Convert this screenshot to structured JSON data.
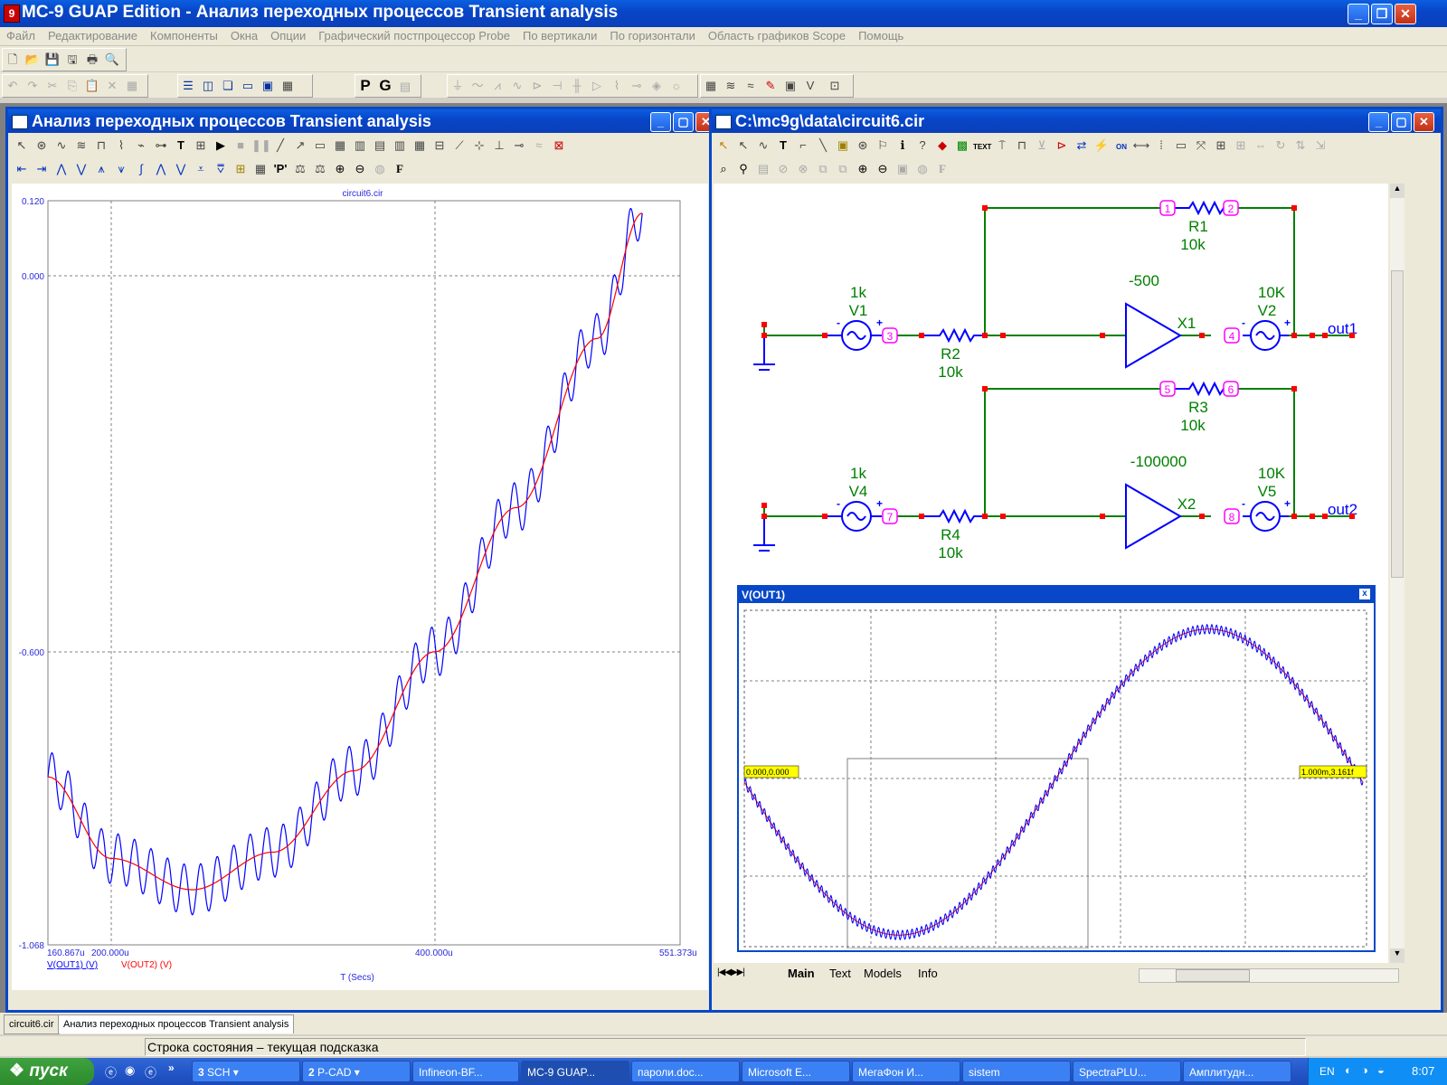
{
  "window": {
    "title": "MC-9 GUAP Edition - Анализ переходных процессов Transient analysis",
    "app_icon": "9"
  },
  "menu": [
    "Файл",
    "Редактирование",
    "Компоненты",
    "Окна",
    "Опции",
    "Графический постпроцессор Probe",
    "По вертикали",
    "По горизонтали",
    "Область графиков Scope",
    "Помощь"
  ],
  "toolbar": {
    "p_label": "P",
    "g_label": "G"
  },
  "analysis_window": {
    "title": "Анализ переходных процессов Transient analysis",
    "toolbar_p": "'P'",
    "toolbar_f": "F",
    "plot": {
      "header": "circuit6.cir",
      "y_ticks": [
        "0.120",
        "0.000",
        "-0.600",
        "-1.068"
      ],
      "x_ticks": [
        "160.867u",
        "200.000u",
        "400.000u",
        "551.373u"
      ],
      "legend": [
        {
          "label": "V(OUT1) (V)",
          "color": "#0000ff"
        },
        {
          "label": "V(OUT2) (V)",
          "color": "#ff0000"
        }
      ],
      "xlabel": "T (Secs)"
    }
  },
  "chart_data": {
    "type": "line",
    "xlabel": "T (Secs)",
    "xlim": [
      160.867,
      551.373
    ],
    "ylim": [
      -1.068,
      0.12
    ],
    "series": [
      {
        "name": "V(OUT1) (V)",
        "color": "#0000ff",
        "base": "parabola",
        "ripple_amplitude": 0.04,
        "ripple_cycles": 36
      },
      {
        "name": "V(OUT2) (V)",
        "color": "#ff0000",
        "base": "parabola"
      }
    ],
    "x": [
      160.867,
      200,
      250,
      300,
      350,
      400,
      450,
      500,
      528
    ],
    "y": [
      -0.8,
      -0.93,
      -0.98,
      -0.92,
      -0.79,
      -0.6,
      -0.37,
      -0.1,
      0.1
    ]
  },
  "schematic_window": {
    "title": "C:\\mc9g\\data\\circuit6.cir",
    "toolbar_text": "TEXT",
    "toolbar_on": "ON",
    "toolbar_f": "F",
    "components": {
      "R1": {
        "name": "R1",
        "value": "10k"
      },
      "R2": {
        "name": "R2",
        "value": "10k"
      },
      "R3": {
        "name": "R3",
        "value": "10k"
      },
      "R4": {
        "name": "R4",
        "value": "10k"
      },
      "V1": {
        "name": "V1",
        "value": "1k"
      },
      "V2": {
        "name": "V2",
        "value": "10K"
      },
      "V4": {
        "name": "V4",
        "value": "1k"
      },
      "V5": {
        "name": "V5",
        "value": "10K"
      },
      "X1": {
        "name": "X1",
        "gain": "-500"
      },
      "X2": {
        "name": "X2",
        "gain": "-100000"
      }
    },
    "nodes": [
      "1",
      "2",
      "3",
      "4",
      "5",
      "6",
      "7",
      "8"
    ],
    "labels": {
      "out1": "out1",
      "out2": "out2",
      "plus": "+",
      "minus": "-"
    },
    "scope": {
      "title": "V(OUT1)",
      "cursor_left": "0.000,0.000",
      "cursor_right": "1.000m,3.161f",
      "close": "x"
    },
    "tabs": [
      "Main",
      "Text",
      "Models",
      "Info"
    ]
  },
  "bottom_tabs": [
    "circuit6.cir",
    "Анализ переходных процессов Transient analysis"
  ],
  "status": "Строка состояния – текущая подсказка",
  "taskbar": {
    "start": "пуск",
    "tasks": [
      {
        "num": "3",
        "label": "SCH"
      },
      {
        "num": "2",
        "label": "P-CAD"
      },
      {
        "label": "Infineon-BF..."
      },
      {
        "label": "MC-9 GUAP..."
      },
      {
        "label": "пароли.doc..."
      },
      {
        "label": "Microsoft E..."
      },
      {
        "label": "МегаФон И..."
      },
      {
        "label": "sistem"
      },
      {
        "label": "SpectraPLU..."
      },
      {
        "label": "Амплитудн..."
      }
    ],
    "lang": "EN",
    "clock": "8:07"
  }
}
